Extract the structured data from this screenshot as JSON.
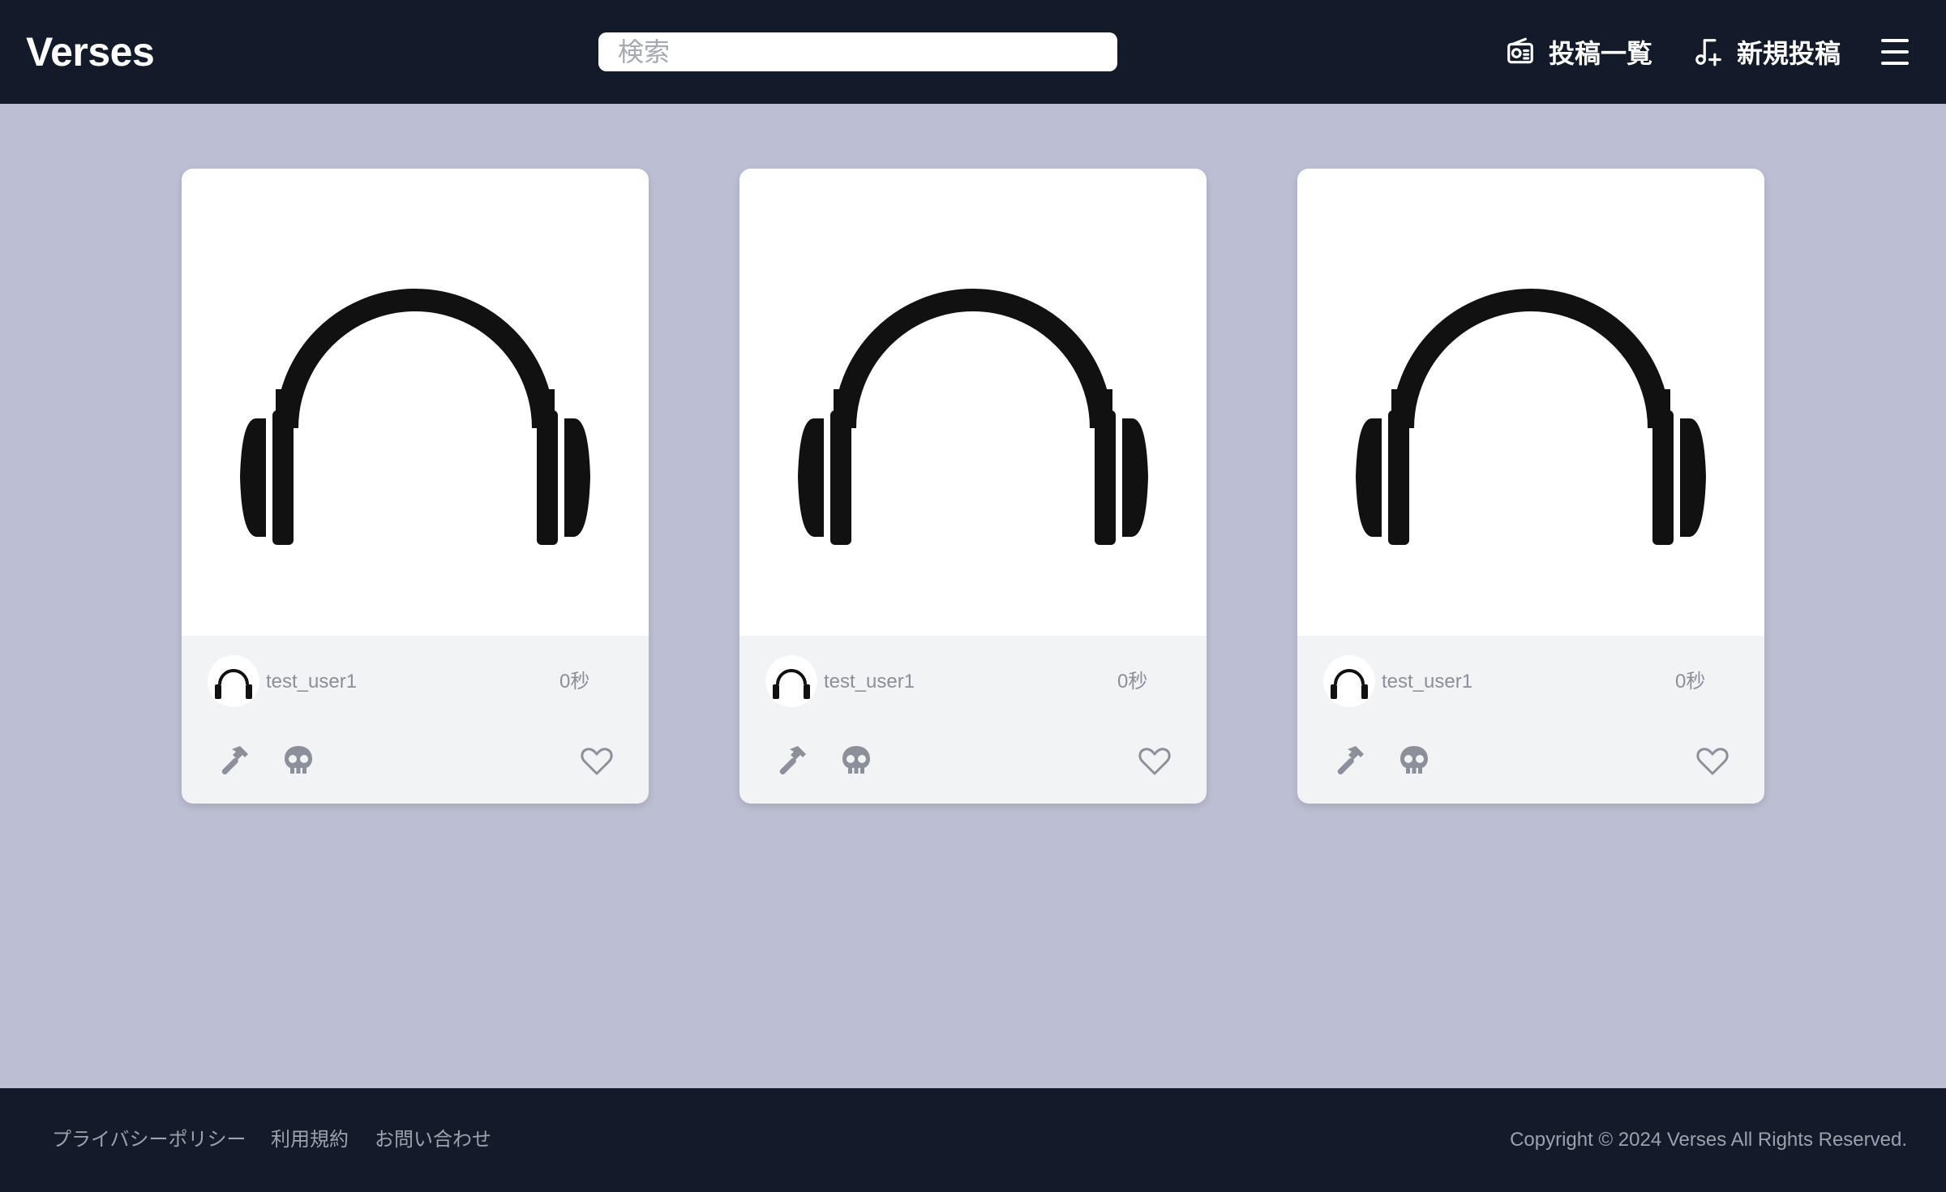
{
  "header": {
    "logo": "Verses",
    "search_placeholder": "検索",
    "nav": {
      "posts_label": "投稿一覧",
      "posts_icon": "radio-icon",
      "new_label": "新規投稿",
      "new_icon": "music-plus-icon"
    },
    "menu_icon": "hamburger-menu-icon"
  },
  "posts": [
    {
      "username": "test_user1",
      "time": "0秒",
      "image_icon": "headphones-icon"
    },
    {
      "username": "test_user1",
      "time": "0秒",
      "image_icon": "headphones-icon"
    },
    {
      "username": "test_user1",
      "time": "0秒",
      "image_icon": "headphones-icon"
    }
  ],
  "post_actions": [
    "hammer-icon",
    "skull-icon",
    "heart-icon"
  ],
  "footer": {
    "links": [
      "プライバシーポリシー",
      "利用規約",
      "お問い合わせ"
    ],
    "copyright": "Copyright © 2024 Verses All Rights Reserved."
  },
  "colors": {
    "header_bg": "#131a2a",
    "page_bg": "#bcbfd3",
    "card_footer_bg": "#f2f3f5",
    "muted_text": "#8b8f99"
  }
}
